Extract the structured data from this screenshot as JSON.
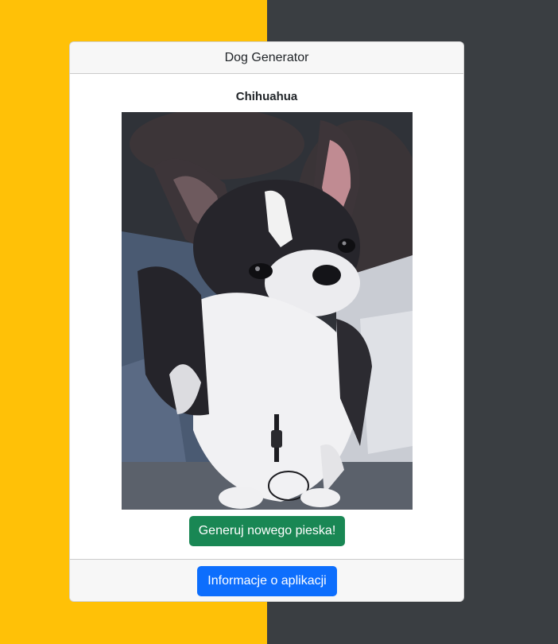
{
  "background": {
    "left_color": "#ffc107",
    "right_color": "#3a3e42"
  },
  "card": {
    "header_title": "Dog Generator",
    "breed_name": "Chihuahua",
    "image_subject": "dog-photo",
    "generate_button_label": "Generuj nowego pieska!",
    "generate_button_color": "#198754",
    "info_button_label": "Informacje o aplikacji",
    "info_button_color": "#0d6efd"
  }
}
